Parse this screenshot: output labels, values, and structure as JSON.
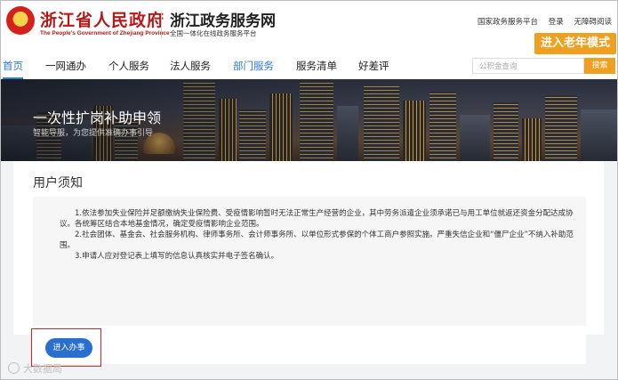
{
  "header": {
    "gov_name": "浙江省人民政府",
    "gov_sub": "The People's Government of Zhejiang Province",
    "site_name": "浙江政务服务网",
    "site_sub": "全国一体化在线政务服务平台",
    "links": [
      "国家政务服务平台",
      "登录",
      "无障碍阅读"
    ],
    "elder_mode": "进入老年模式",
    "accent_color": "#f0a020",
    "brand_color": "#b51a1a"
  },
  "nav": {
    "items": [
      "首页",
      "一网通办",
      "个人服务",
      "法人服务",
      "部门服务",
      "服务清单",
      "好差评"
    ],
    "active_index": 0,
    "highlight_index": 4,
    "search_placeholder": "公积金查询",
    "search_button": "搜索"
  },
  "banner": {
    "title": "一次性扩岗补助申领",
    "subtitle": "智能导服，为您提供准确办事引导"
  },
  "notice": {
    "title": "用户须知",
    "paragraphs": [
      "1.依法参加失业保险并足额缴纳失业保险费、受疫情影响暂时无法正常生产经营的企业，其中劳务派遣企业须承诺已与用工单位就返还资金分配达成协议。各统筹区结合本地基金情况，确定受疫情影响企业范围。",
      "2.社会团体、基金会、社会服务机构、律师事务所、会计师事务所、以单位形式参保的个体工商户参照实施。严重失信企业和“僵尸企业”不纳入补助范围。",
      "3.申请人应对登记表上填写的信息认真核实并电子签名确认。"
    ]
  },
  "action": {
    "enter_button": "进入办事"
  },
  "watermark": {
    "text": "大数据局"
  }
}
